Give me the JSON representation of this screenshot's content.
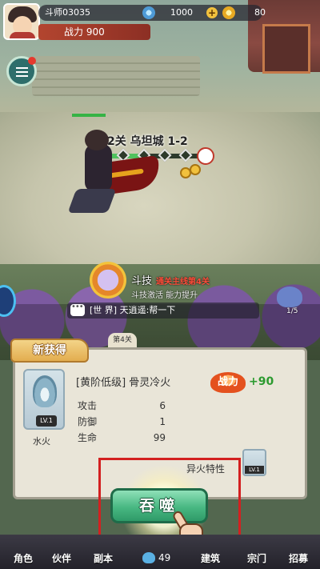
{
  "player": {
    "name": "斗师03035",
    "gems": "1000",
    "gold": "80",
    "power": "战力 900"
  },
  "stage": {
    "title": "第2关 乌坦城 1-2",
    "progress": 0.5
  },
  "duel": {
    "title": "斗技",
    "requirement": "通关主线第4关",
    "subtitle": "斗技激活 能力提升"
  },
  "pet_counter": "1/5",
  "chat": {
    "text": "[世 界] 天逍遥:帮一下"
  },
  "stage_chip": "第4关",
  "popup": {
    "title": "新获得",
    "item_level": "LV.1",
    "item_caption": "水火",
    "item_name": "[黄阶低级] 骨灵冷火",
    "power_label": "战力",
    "power_gain": "+90",
    "stats": [
      {
        "label": "攻击",
        "value": "6"
      },
      {
        "label": "防御",
        "value": "1"
      },
      {
        "label": "生命",
        "value": "99"
      }
    ],
    "trait_label": "异火特性",
    "trait_level": "LV.1",
    "devour_button": "吞噬"
  },
  "nav": {
    "items": [
      "角色",
      "伙伴",
      "副本",
      "建筑",
      "宗门",
      "招募"
    ],
    "energy": "49"
  }
}
